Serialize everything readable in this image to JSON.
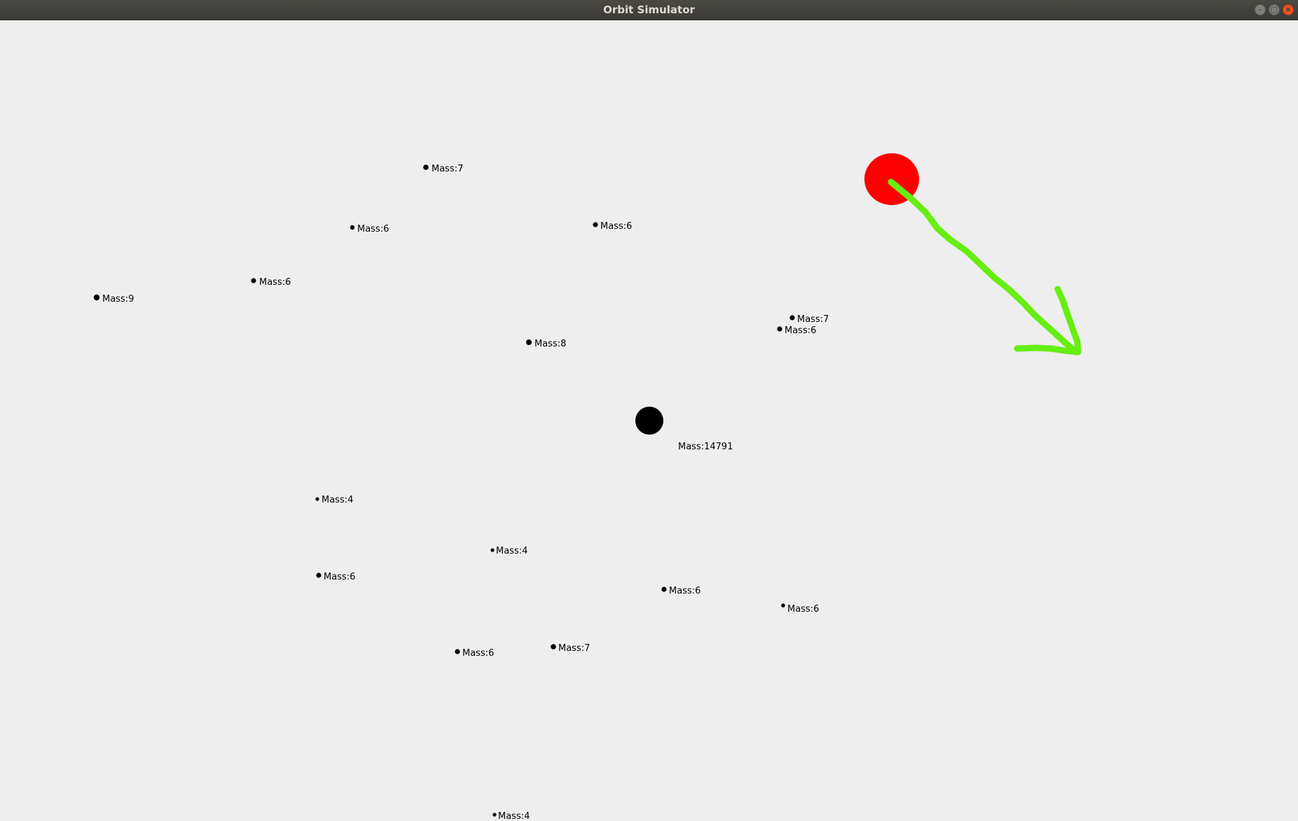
{
  "window": {
    "title": "Orbit Simulator",
    "controls": {
      "minimize": "–",
      "maximize": "□",
      "close": "×"
    }
  },
  "colors": {
    "background": "#eeeeee",
    "body": "#000000",
    "selected_body": "#ff0000",
    "velocity_arrow": "#66ee11",
    "titlebar": "#3c3b37"
  },
  "central_body": {
    "label": "Mass:14791"
  },
  "selected_body": {
    "color_name": "red"
  },
  "bodies": [
    {
      "label": "Mass:7"
    },
    {
      "label": "Mass:6"
    },
    {
      "label": "Mass:6"
    },
    {
      "label": "Mass:6"
    },
    {
      "label": "Mass:9"
    },
    {
      "label": "Mass:7"
    },
    {
      "label": "Mass:6"
    },
    {
      "label": "Mass:8"
    },
    {
      "label": "Mass:4"
    },
    {
      "label": "Mass:4"
    },
    {
      "label": "Mass:6"
    },
    {
      "label": "Mass:6"
    },
    {
      "label": "Mass:6"
    },
    {
      "label": "Mass:6"
    },
    {
      "label": "Mass:7"
    },
    {
      "label": "Mass:4"
    }
  ]
}
